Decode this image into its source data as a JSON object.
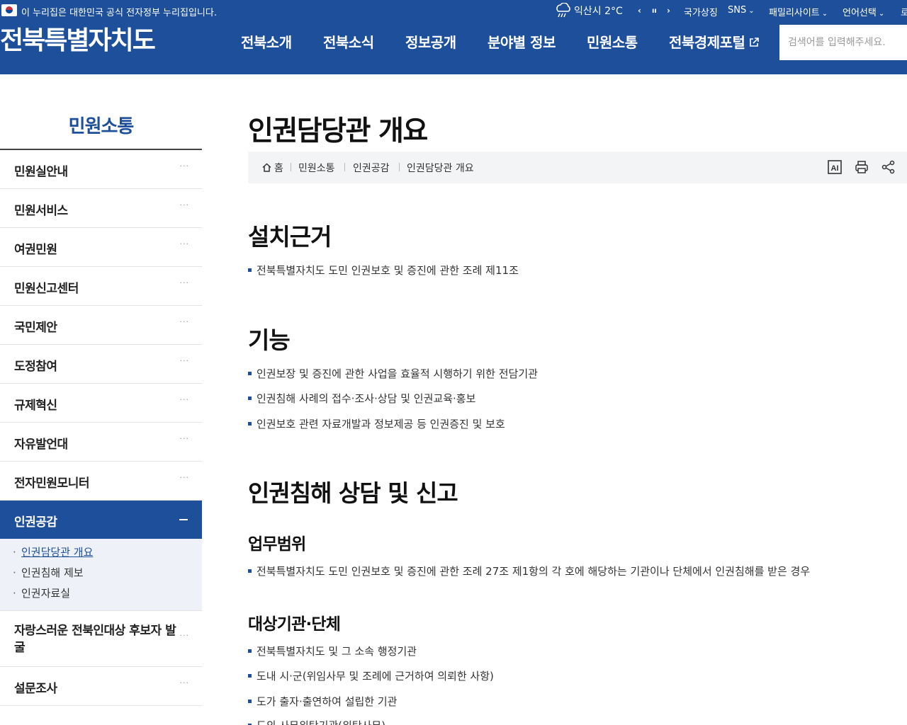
{
  "header": {
    "gov_banner": "이 누리집은 대한민국 공식 전자정부 누리집입니다.",
    "weather": "익산시 2°C",
    "controls": {
      "prev": "‹",
      "pause": "ıı",
      "next": "›"
    },
    "top_links": [
      "국가상징",
      "SNS",
      "패밀리사이트",
      "언어선택"
    ],
    "top_link_extra": "로",
    "logo": "전북특별자치도",
    "gnb": [
      "전북소개",
      "전북소식",
      "정보공개",
      "분야별 정보",
      "민원소통",
      "전북경제포털"
    ],
    "search_placeholder": "검색어를 입력해주세요.",
    "brand_color": "#1d4f9b"
  },
  "sidebar": {
    "title": "민원소통",
    "items": [
      {
        "label": "민원실안내",
        "more": "···"
      },
      {
        "label": "민원서비스",
        "more": "···"
      },
      {
        "label": "여권민원",
        "more": "···"
      },
      {
        "label": "민원신고센터",
        "more": "···"
      },
      {
        "label": "국민제안",
        "more": "···"
      },
      {
        "label": "도정참여",
        "more": "···"
      },
      {
        "label": "규제혁신",
        "more": "···"
      },
      {
        "label": "자유발언대",
        "more": "···"
      },
      {
        "label": "전자민원모니터",
        "more": "···"
      },
      {
        "label": "인권공감",
        "more": "−"
      }
    ],
    "sub_items": [
      "인권담당관 개요",
      "인권침해 제보",
      "인권자료실"
    ],
    "items_after": [
      {
        "label": "자랑스러운 전북인대상 후보자 발굴",
        "more": "···"
      },
      {
        "label": "설문조사",
        "more": "···"
      }
    ]
  },
  "content": {
    "title": "인권담당관 개요",
    "breadcrumb": [
      "홈",
      "민원소통",
      "인권공감",
      "인권담당관 개요"
    ],
    "tools": [
      "AI",
      "print",
      "share"
    ],
    "sections": {
      "basis_title": "설치근거",
      "basis_items": [
        "전북특별자치도 도민 인권보호 및 증진에 관한 조례 제11조"
      ],
      "function_title": "기능",
      "function_items": [
        "인권보장 및 증진에 관한 사업을 효율적 시행하기 위한 전담기관",
        "인권침해 사례의 접수·조사·상담 및 인권교육·홍보",
        "인권보호 관련 자료개발과 정보제공 등 인권증진 및 보호"
      ],
      "consult_title": "인권침해 상담 및 신고",
      "scope_title": "업무범위",
      "scope_items": [
        "전북특별자치도 도민 인권보호 및 증진에 관한 조례 27조 제1항의 각 호에 해당하는 기관이나 단체에서 인권침해를 받은 경우"
      ],
      "target_title": "대상기관·단체",
      "target_items": [
        "전북특별자치도 및 그 소속 행정기관",
        "도내 시·군(위임사무 및 조례에 근거하여 의뢰한 사항)",
        "도가 출자·출연하여 설립한 기관",
        "도의 사무위탁기관(위탁사무)"
      ]
    }
  }
}
